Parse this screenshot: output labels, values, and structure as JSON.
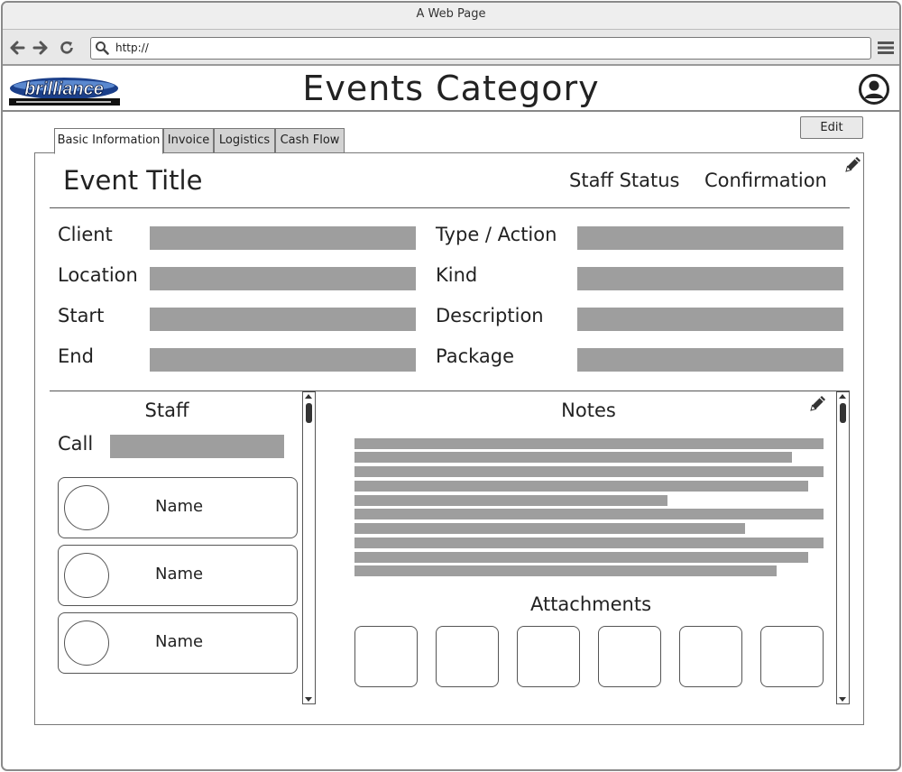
{
  "browser": {
    "window_title": "A Web Page",
    "url": "http://"
  },
  "header": {
    "logo_alt": "brilliance logo",
    "page_title": "Events Category"
  },
  "toolbar": {
    "edit_label": "Edit"
  },
  "tabs": [
    {
      "label": "Basic Information",
      "active": true
    },
    {
      "label": "Invoice",
      "active": false
    },
    {
      "label": "Logistics",
      "active": false
    },
    {
      "label": "Cash Flow",
      "active": false
    }
  ],
  "event": {
    "title": "Event Title",
    "staff_status": "Staff Status",
    "confirmation": "Confirmation"
  },
  "fields": {
    "left": [
      {
        "label": "Client"
      },
      {
        "label": "Location"
      },
      {
        "label": "Start"
      },
      {
        "label": "End"
      }
    ],
    "right": [
      {
        "label": "Type / Action"
      },
      {
        "label": "Kind"
      },
      {
        "label": "Description"
      },
      {
        "label": "Package"
      }
    ]
  },
  "staff": {
    "title": "Staff",
    "call_label": "Call",
    "members": [
      {
        "name": "Name"
      },
      {
        "name": "Name"
      },
      {
        "name": "Name"
      }
    ]
  },
  "notes": {
    "title": "Notes",
    "attachments_title": "Attachments",
    "attachment_count": 6,
    "placeholder_line_count": 10
  },
  "colors": {
    "placeholder_bar": "#9e9e9e",
    "tab_inactive": "#d3d3d3",
    "button_bg": "#e9e9e9"
  }
}
